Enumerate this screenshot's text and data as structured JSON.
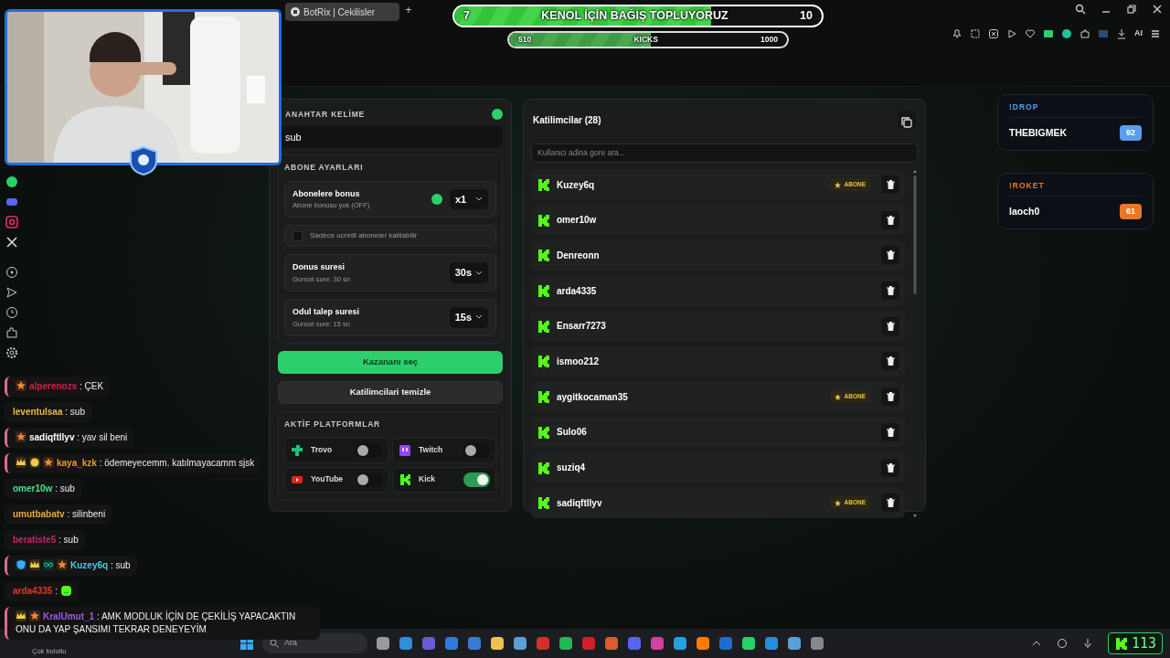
{
  "browser": {
    "tab_title": "BotRix | Cekilisler",
    "new_tab": "+",
    "toolbar_ai": "AI"
  },
  "goal_bar": {
    "start": "7",
    "title": "KENOL İÇİN BAĞIŞ TOPLUYORUZ",
    "end": "10",
    "level": 0.7
  },
  "kicks_bar": {
    "start": "510",
    "title": "KICKS",
    "end": "1000",
    "level": 0.51
  },
  "keyword": {
    "label": "ANAHTAR KELİME",
    "value": "sub"
  },
  "sub_settings": {
    "title": "ABONE AYARLARI",
    "bonus": {
      "title": "Abonelere bonus",
      "subtitle": "Abone bonusu yok (OFF)",
      "value": "x1"
    },
    "paid_only": {
      "label": "Sadece ucretli aboneler katilabilir",
      "checked": false
    },
    "timers": [
      {
        "title": "Donus suresi",
        "subtitle": "Guncel sure: 30 sn",
        "value": "30s"
      },
      {
        "title": "Odul talep suresi",
        "subtitle": "Guncel sure: 15 sn",
        "value": "15s"
      }
    ]
  },
  "buttons": [
    {
      "label": "Kazananı seç",
      "kind": "primary"
    },
    {
      "label": "Katilimcilari temizle",
      "kind": "secondary"
    }
  ],
  "platforms": {
    "title": "AKTİF PLATFORMLAR",
    "items": [
      {
        "name": "Trovo",
        "kind": "trovo",
        "on": false
      },
      {
        "name": "Twitch",
        "kind": "twitch",
        "on": false
      },
      {
        "name": "YouTube",
        "kind": "youtube",
        "on": false
      },
      {
        "name": "Kick",
        "kind": "kick",
        "on": true
      }
    ]
  },
  "participants": {
    "title": "Katilimcilar (28)",
    "search_placeholder": "Kullanici adina gore ara...",
    "rows": [
      {
        "name": "Kuzey6q",
        "badge": "ABONE"
      },
      {
        "name": "omer10w"
      },
      {
        "name": "Denreonn"
      },
      {
        "name": "arda4335"
      },
      {
        "name": "Ensarr7273"
      },
      {
        "name": "ismoo212"
      },
      {
        "name": "aygitkocaman35",
        "badge": "ABONE"
      },
      {
        "name": "Sulo06"
      },
      {
        "name": "suziq4"
      },
      {
        "name": "sadiqftllyv",
        "badge": "ABONE"
      }
    ]
  },
  "leaderboards": [
    {
      "title": "!DROP",
      "color": "#5b9cf0",
      "name": "THEBIGMEK",
      "score": "92"
    },
    {
      "title": "!ROKET",
      "color": "#e8782a",
      "name": "laoch0",
      "score": "61"
    }
  ],
  "chat": [
    {
      "user": "alperenozs",
      "color": "#d0214f",
      "separator": ":",
      "message": "ÇEK",
      "badges": [
        {
          "kind": "star"
        }
      ],
      "highlighted": true
    },
    {
      "user": "leventulsaa",
      "color": "#eab64c",
      "separator": ":",
      "message": "sub",
      "highlighted": false
    },
    {
      "user": "sadiqftllyv",
      "color": "#ffffff",
      "separator": ":",
      "message": "yav sil beni",
      "badges": [
        {
          "kind": "star"
        }
      ],
      "highlighted": true
    },
    {
      "user": "kaya_kzk",
      "color": "#e99a2c",
      "separator": ":",
      "message": "ödemeyecemm. katılmayacamm sjsk",
      "badges": [
        {
          "kind": "crown"
        },
        {
          "kind": "coin"
        },
        {
          "kind": "star"
        }
      ],
      "highlighted": true
    },
    {
      "user": "omer10w",
      "color": "#4ee08a",
      "separator": ":",
      "message": "sub",
      "highlighted": false
    },
    {
      "user": "umutbabatv",
      "color": "#e8a838",
      "separator": ":",
      "message": "silinbeni",
      "highlighted": false
    },
    {
      "user": "beratiste5",
      "color": "#d0216a",
      "separator": ":",
      "message": "sub",
      "highlighted": false
    },
    {
      "user": "Kuzey6q",
      "color": "#3fd0e0",
      "separator": ":",
      "message": "sub",
      "badges": [
        {
          "kind": "shield"
        },
        {
          "kind": "crown"
        },
        {
          "kind": "glasses"
        },
        {
          "kind": "star"
        }
      ],
      "highlighted": true
    },
    {
      "user": "arda4335",
      "color": "#e03a2a",
      "separator": ":",
      "emote": true,
      "highlighted": false
    },
    {
      "user": "KralUmut_1",
      "color": "#9b5de5",
      "separator": ":",
      "message": "AMK MODLUK İÇİN DE ÇEKİLİŞ YAPACAKTIN ONU DA YAP ŞANSIMI TEKRAR DENEYEYİM",
      "badges": [
        {
          "kind": "crown"
        },
        {
          "kind": "star"
        }
      ],
      "highlighted": true
    }
  ],
  "taskbar": {
    "weather": "Çok bulutlu",
    "search_placeholder": "Ara",
    "counter": "113"
  }
}
